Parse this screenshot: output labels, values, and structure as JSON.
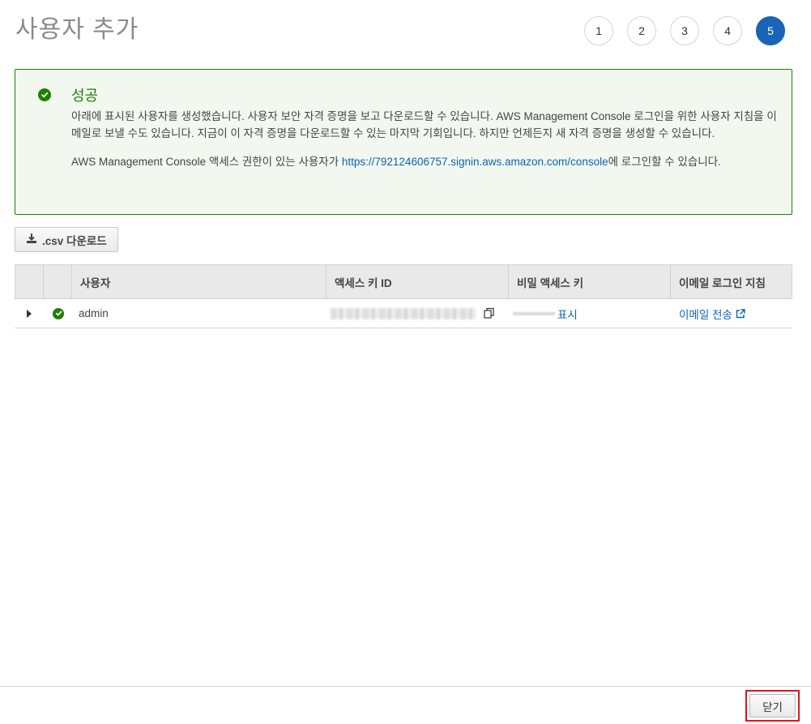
{
  "page": {
    "title": "사용자 추가"
  },
  "steps": [
    {
      "label": "1"
    },
    {
      "label": "2"
    },
    {
      "label": "3"
    },
    {
      "label": "4"
    },
    {
      "label": "5",
      "active": true
    }
  ],
  "alert": {
    "title": "성공",
    "line1": "아래에 표시된 사용자를 생성했습니다. 사용자 보안 자격 증명을 보고 다운로드할 수 있습니다. AWS Management Console 로그인을 위한 사용자 지침을 이메일로 보낼 수도 있습니다. 지금이 이 자격 증명을 다운로드할 수 있는 마지막 기회입니다. 하지만 언제든지 새 자격 증명을 생성할 수 있습니다.",
    "console_prefix": "AWS Management Console 액세스 권한이 있는 사용자가 ",
    "console_url": "https://792124606757.signin.aws.amazon.com/console",
    "console_suffix": "에 로그인할 수 있습니다.",
    "icon": "check-circle-icon",
    "color": "#1d8102"
  },
  "actions": {
    "download_csv_label": ".csv 다운로드"
  },
  "table": {
    "columns": {
      "user": "사용자",
      "access_key_id": "액세스 키 ID",
      "secret_key": "비밀 액세스 키",
      "email_instructions": "이메일 로그인 지침"
    },
    "rows": [
      {
        "user": "admin",
        "status": "success",
        "secret_action": "표시",
        "email_action": "이메일 전송"
      }
    ]
  },
  "footer": {
    "close_label": "닫기"
  },
  "colors": {
    "accent": "#1a64b6",
    "link": "#0b63b5",
    "success": "#1d8102",
    "highlight": "#e2141a"
  }
}
